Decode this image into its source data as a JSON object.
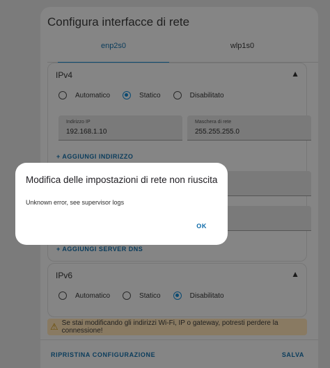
{
  "card": {
    "title": "Configura interfacce di rete",
    "tabs": [
      "enp2s0",
      "wlp1s0"
    ]
  },
  "ipv4": {
    "title": "IPv4",
    "modes": [
      "Automatico",
      "Statico",
      "Disabilitato"
    ],
    "selected_mode": "Statico",
    "ip_field": {
      "label": "Indirizzo IP",
      "value": "192.168.1.10"
    },
    "mask_field": {
      "label": "Maschera di rete",
      "value": "255.255.255.0"
    },
    "add_address": "+ AGGIUNGI INDIRIZZO",
    "add_dns": "+ AGGIUNGI SERVER DNS"
  },
  "ipv6": {
    "title": "IPv6",
    "modes": [
      "Automatico",
      "Statico",
      "Disabilitato"
    ],
    "selected_mode": "Disabilitato"
  },
  "warning": "Se stai modificando gli indirizzi Wi-Fi, IP o gateway, potresti perdere la connessione!",
  "footer": {
    "reset": "RIPRISTINA CONFIGURAZIONE",
    "save": "SALVA"
  },
  "dialog": {
    "title": "Modifica delle impostazioni di rete non riuscita",
    "message": "Unknown error, see supervisor logs",
    "ok": "OK"
  },
  "icons": {
    "chevron": "chevron-up-icon",
    "warning": "warning-icon"
  },
  "colors": {
    "accent": "#0a69a8",
    "scrim": "#7b7b7b",
    "dialog_bg": "#ffffff"
  }
}
